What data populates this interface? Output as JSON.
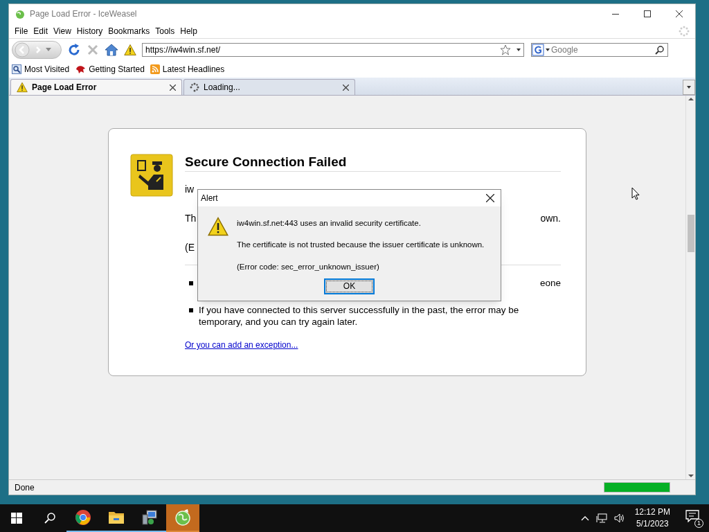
{
  "window": {
    "title": "Page Load Error - IceWeasel"
  },
  "menu": [
    "File",
    "Edit",
    "View",
    "History",
    "Bookmarks",
    "Tools",
    "Help"
  ],
  "address": {
    "value": "https://iw4win.sf.net/"
  },
  "search": {
    "placeholder": "Google"
  },
  "bookmarks": [
    {
      "label": "Most Visited",
      "kind": "search"
    },
    {
      "label": "Getting Started",
      "kind": "bird"
    },
    {
      "label": "Latest Headlines",
      "kind": "feed"
    }
  ],
  "tabs": [
    {
      "label": "Page Load Error",
      "selected": true,
      "kind": "warning"
    },
    {
      "label": "Loading...",
      "selected": false,
      "kind": "loading"
    }
  ],
  "error_page": {
    "title": "Secure Connection Failed",
    "fragments": [
      {
        "left": "iw"
      },
      {
        "left": "Th",
        "right": "own."
      },
      {
        "left": "(E"
      }
    ],
    "bullets": [
      {
        "right": "eone"
      },
      {
        "left": "If you have connected to this server successfully in the past, the error may be temporary, and you can try again later."
      }
    ],
    "link": "Or you can add an exception..."
  },
  "dialog": {
    "title": "Alert",
    "lines": [
      "iw4win.sf.net:443 uses an invalid security certificate.",
      "The certificate is not trusted because the issuer certificate is unknown.",
      "(Error code: sec_error_unknown_issuer)"
    ],
    "button": "OK"
  },
  "status_bar": {
    "text": "Done",
    "level": 1
  },
  "taskbar": {
    "apps": [
      {
        "kind": "chrome",
        "selected": false
      },
      {
        "kind": "folder",
        "selected": false
      },
      {
        "kind": "installer",
        "selected": false
      },
      {
        "kind": "iceweasel",
        "selected": true
      }
    ],
    "time": "12:12 PM",
    "date": "5/1/2023",
    "notifications": "1"
  }
}
